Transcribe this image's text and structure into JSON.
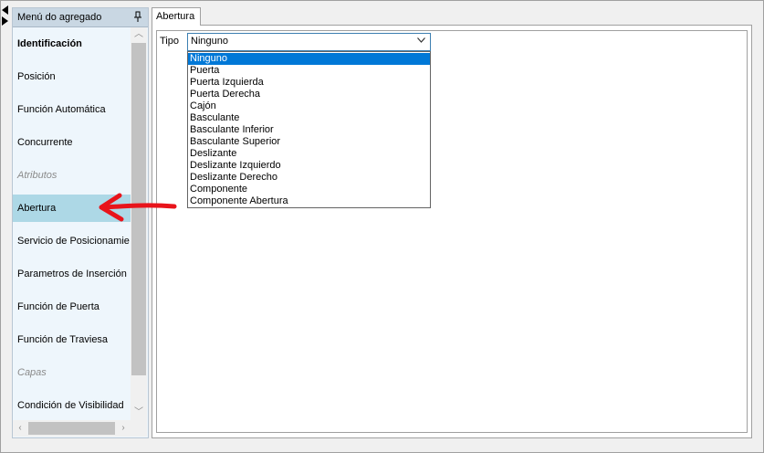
{
  "side_panel": {
    "title": "Menú do agregado",
    "items": [
      {
        "label": "Identificación",
        "kind": "bold"
      },
      {
        "label": "Posición",
        "kind": "normal"
      },
      {
        "label": "Función Automática",
        "kind": "normal"
      },
      {
        "label": "Concurrente",
        "kind": "normal"
      },
      {
        "label": "Atributos",
        "kind": "category"
      },
      {
        "label": "Abertura",
        "kind": "selected"
      },
      {
        "label": "Servicio de Posicionamie",
        "kind": "normal"
      },
      {
        "label": "Parametros de Inserción",
        "kind": "normal"
      },
      {
        "label": "Función de Puerta",
        "kind": "normal"
      },
      {
        "label": "Función de Traviesa",
        "kind": "normal"
      },
      {
        "label": "Capas",
        "kind": "category"
      },
      {
        "label": "Condición de Visibilidad",
        "kind": "normal"
      }
    ]
  },
  "tab": {
    "label": "Abertura"
  },
  "form": {
    "tipo_label": "Tipo",
    "tipo_value": "Ninguno",
    "options": [
      "Ninguno",
      "Puerta",
      "Puerta Izquierda",
      "Puerta Derecha",
      "Cajón",
      "Basculante",
      "Basculante Inferior",
      "Basculante Superior",
      "Deslizante",
      "Deslizante Izquierdo",
      "Deslizante Derecho",
      "Componente",
      "Componente Abertura"
    ],
    "selected_option": "Ninguno"
  },
  "colors": {
    "selected_item_bg": "#add8e6",
    "dropdown_highlight": "#0078d7",
    "annotation_arrow": "#e8141b"
  }
}
